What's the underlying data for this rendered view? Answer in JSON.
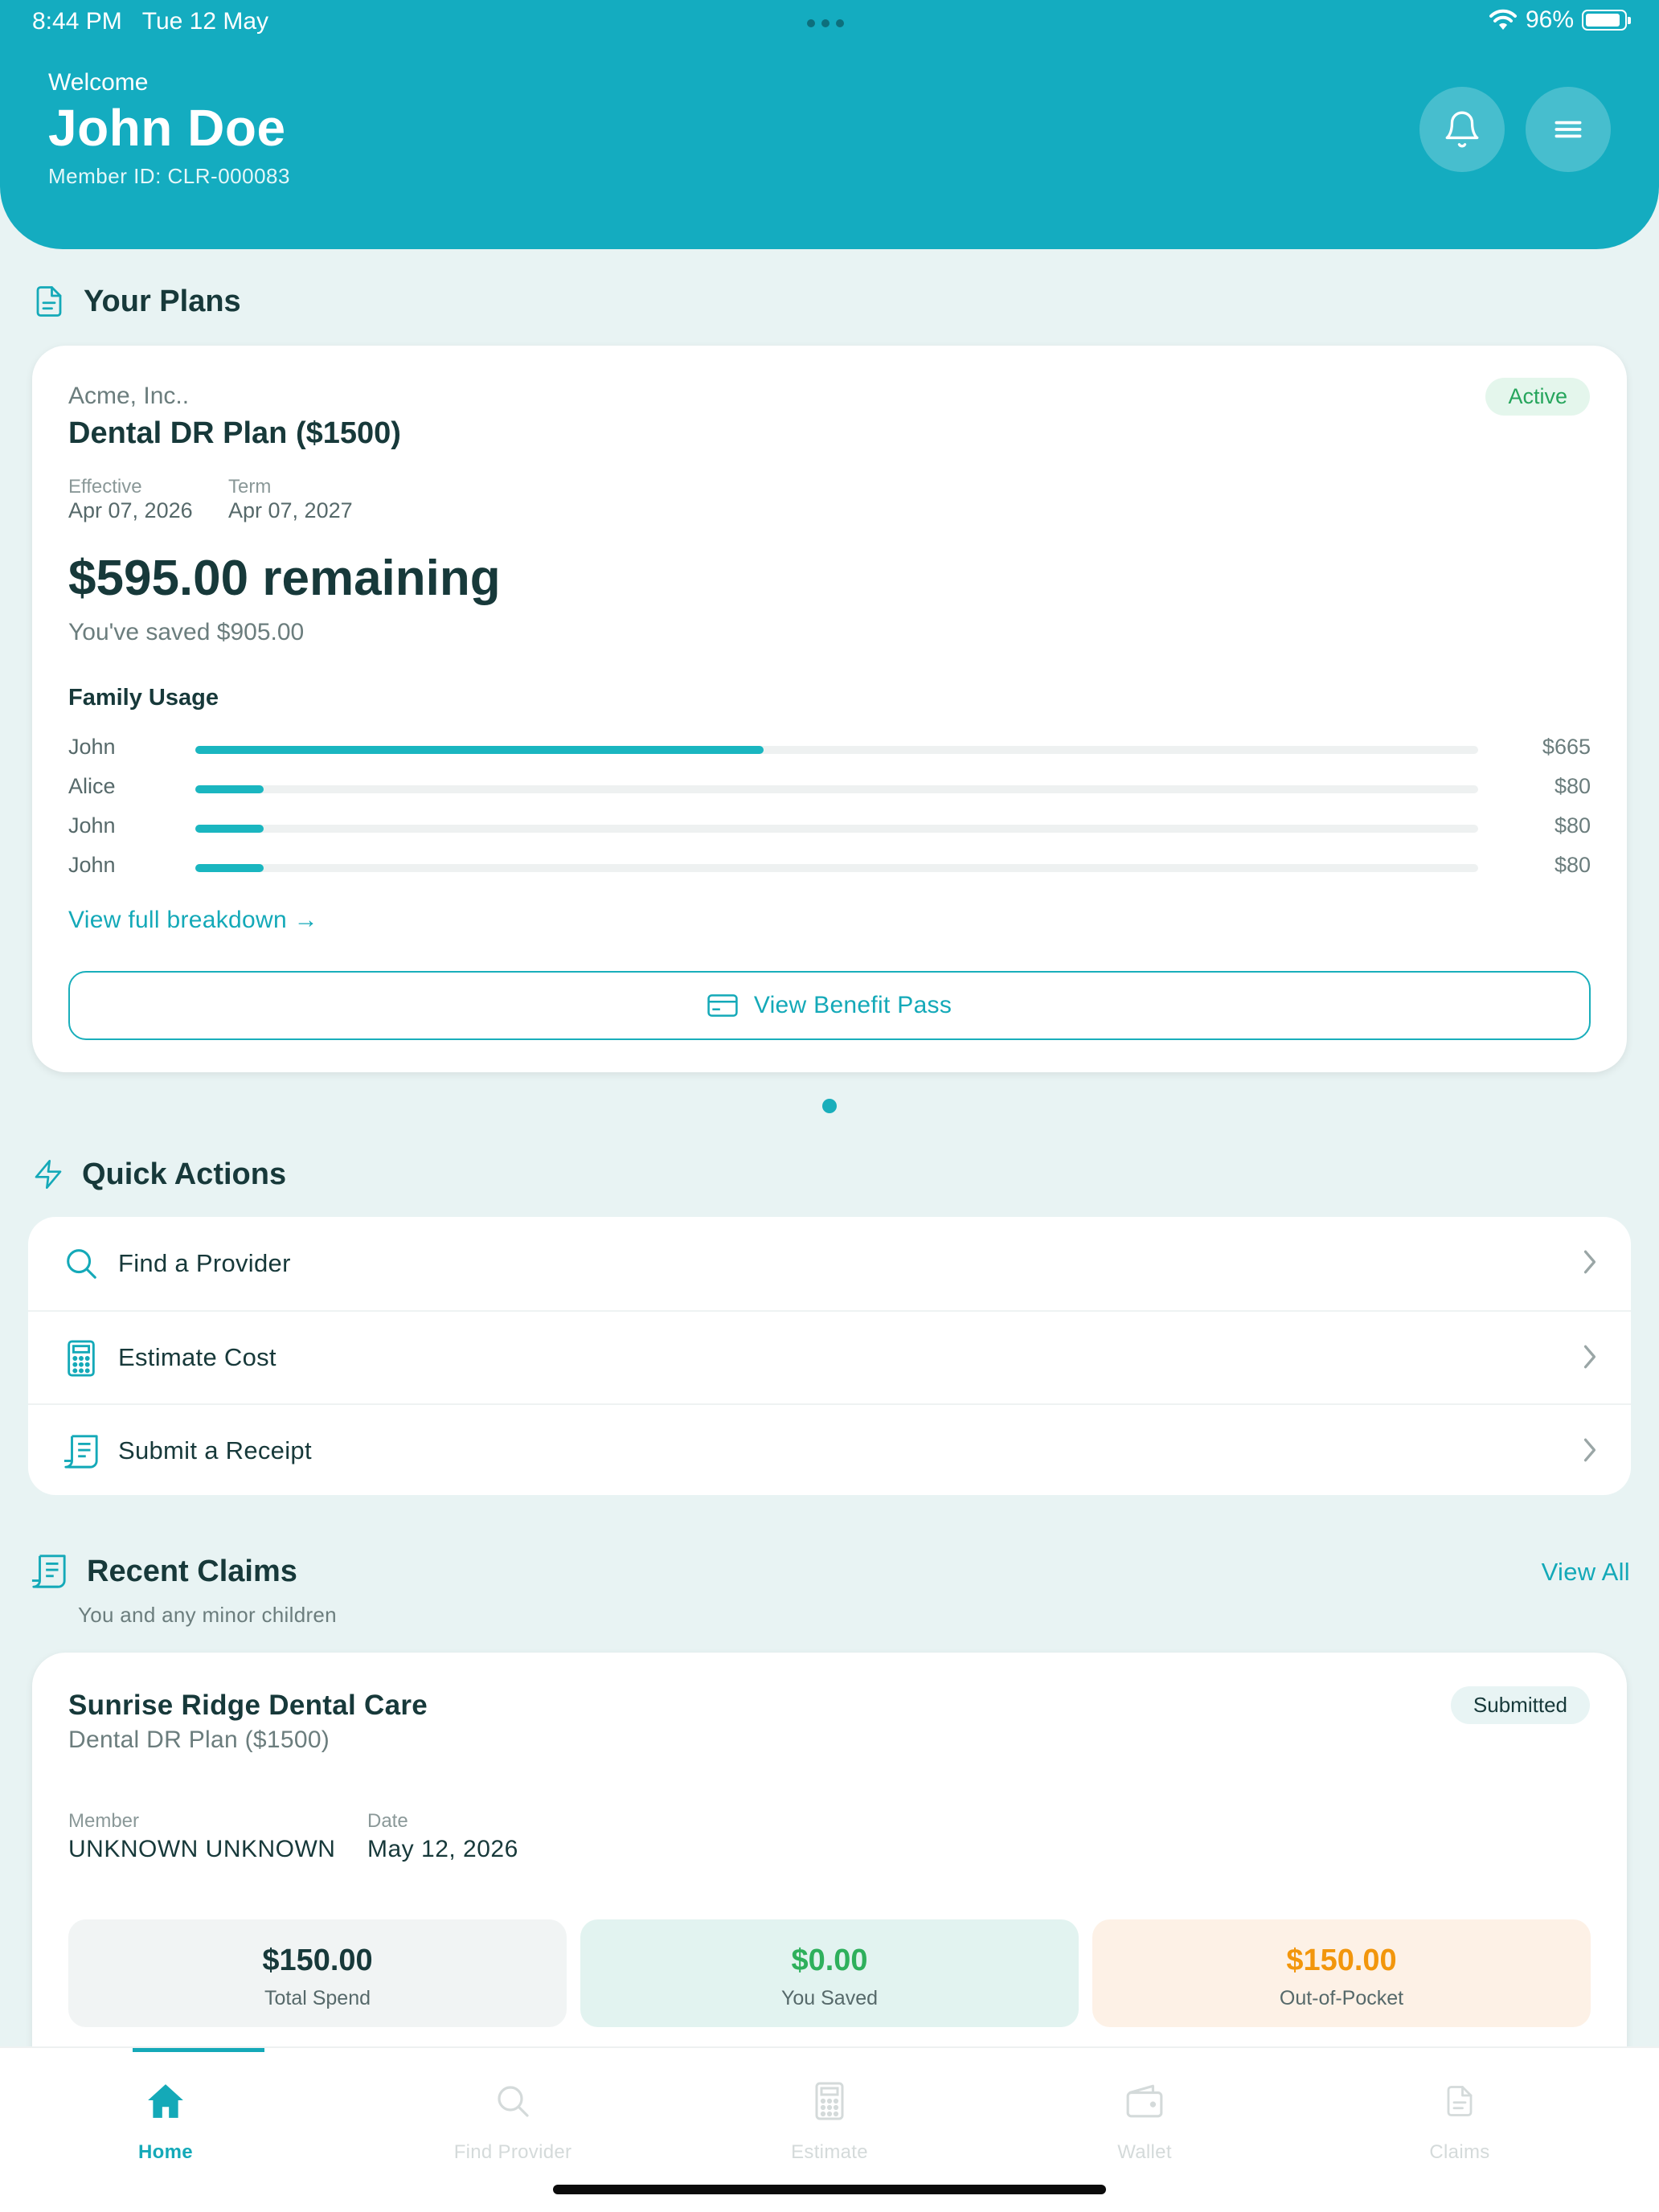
{
  "status_bar": {
    "time": "8:44 PM",
    "date": "Tue 12 May",
    "battery": "96%"
  },
  "header": {
    "welcome": "Welcome",
    "user_name": "John Doe",
    "member_id": "Member ID: CLR-000083",
    "icons": [
      "bell-icon",
      "menu-icon"
    ]
  },
  "plans": {
    "section_title": "Your Plans",
    "employer": "Acme, Inc..",
    "plan_name": "Dental DR Plan ($1500)",
    "status": "Active",
    "effective_label": "Effective",
    "effective_date": "Apr 07, 2026",
    "term_label": "Term",
    "term_date": "Apr 07, 2027",
    "remaining": "$595.00 remaining",
    "saved": "You've saved $905.00",
    "family_usage_title": "Family Usage",
    "family_usage": [
      {
        "name": "John",
        "amount": "$665",
        "fraction": 0.443
      },
      {
        "name": "Alice",
        "amount": "$80",
        "fraction": 0.053
      },
      {
        "name": "John",
        "amount": "$80",
        "fraction": 0.053
      },
      {
        "name": "John",
        "amount": "$80",
        "fraction": 0.053
      }
    ],
    "breakdown_link": "View full breakdown →",
    "benefit_pass_button": "View Benefit Pass"
  },
  "quick_actions": {
    "section_title": "Quick Actions",
    "items": [
      {
        "label": "Find a Provider",
        "icon": "search-icon"
      },
      {
        "label": "Estimate Cost",
        "icon": "calculator-icon"
      },
      {
        "label": "Submit a Receipt",
        "icon": "receipt-icon"
      }
    ]
  },
  "recent_claims": {
    "section_title": "Recent Claims",
    "subtitle": "You and any minor children",
    "view_all": "View All",
    "claim": {
      "provider": "Sunrise Ridge Dental Care",
      "plan": "Dental DR Plan ($1500)",
      "status": "Submitted",
      "member_label": "Member",
      "member": "UNKNOWN UNKNOWN",
      "date_label": "Date",
      "date": "May 12, 2026",
      "total_spend": "$150.00",
      "total_spend_label": "Total Spend",
      "you_saved": "$0.00",
      "you_saved_label": "You Saved",
      "out_of_pocket": "$150.00",
      "out_of_pocket_label": "Out-of-Pocket"
    }
  },
  "tab_bar": {
    "active": "Home",
    "tabs": [
      {
        "label": "Home",
        "icon": "home-icon"
      },
      {
        "label": "Find Provider",
        "icon": "search-icon"
      },
      {
        "label": "Estimate",
        "icon": "calculator-icon"
      },
      {
        "label": "Wallet",
        "icon": "wallet-icon"
      },
      {
        "label": "Claims",
        "icon": "document-icon"
      }
    ]
  },
  "colors": {
    "brand": "#14acc0",
    "accent": "#19aebb",
    "background": "#e8f3f3",
    "active_green": "#26a55c",
    "saved_green": "#2eb05c",
    "out_of_pocket_orange": "#f2960c"
  }
}
